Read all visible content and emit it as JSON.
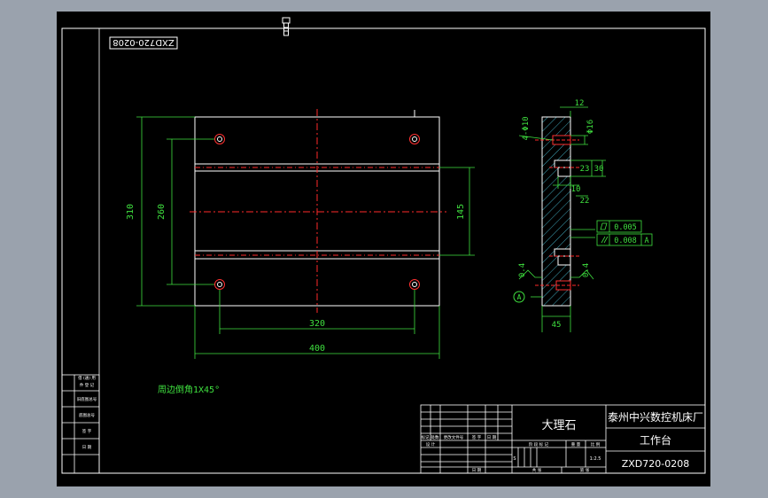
{
  "drawing": {
    "code_stamp": "ZXD720-0208",
    "note": "周边倒角1X45°",
    "plan_view": {
      "dims": {
        "height_total": "310",
        "height_holes": "260",
        "slot_span": "145",
        "width_holes": "320",
        "width_total": "400"
      }
    },
    "section_view": {
      "dims": {
        "top": "12",
        "hole_label": "4-Φ10",
        "dia": "Φ16",
        "d23": "23",
        "d30": "30",
        "d10": "10",
        "d22": "22",
        "thick": "45"
      },
      "tolerances": {
        "flatness": "0.005",
        "parallel": "0.008",
        "datum": "A"
      },
      "roughness": [
        "0.4",
        "0.4"
      ],
      "datum_mark": "A"
    }
  },
  "left_table": [
    "借 (通) 用",
    "件 登 记",
    "旧底图总号",
    "底图总号",
    "签 字",
    "日 期"
  ],
  "title_block": {
    "material": "大理石",
    "company": "泰州中兴数控机床厂",
    "part_name": "工作台",
    "drawing_number": "ZXD720-0208",
    "rev_headers": [
      "标记",
      "处数",
      "更改文件号",
      "签 字",
      "日 期"
    ],
    "row_design": "设 计",
    "row_date": "日 期",
    "stage_headers": [
      "阶 段 标 记",
      "重 量",
      "比 例"
    ],
    "scale": "1:2.5",
    "stage_s": "S",
    "sheet_total": "共   张",
    "sheet_no": "第   张"
  },
  "colors": {
    "drawing_line": "#ffffff",
    "dimension": "#3fe03f",
    "centerline": "#ff2a2a",
    "hole": "#ff3030"
  }
}
